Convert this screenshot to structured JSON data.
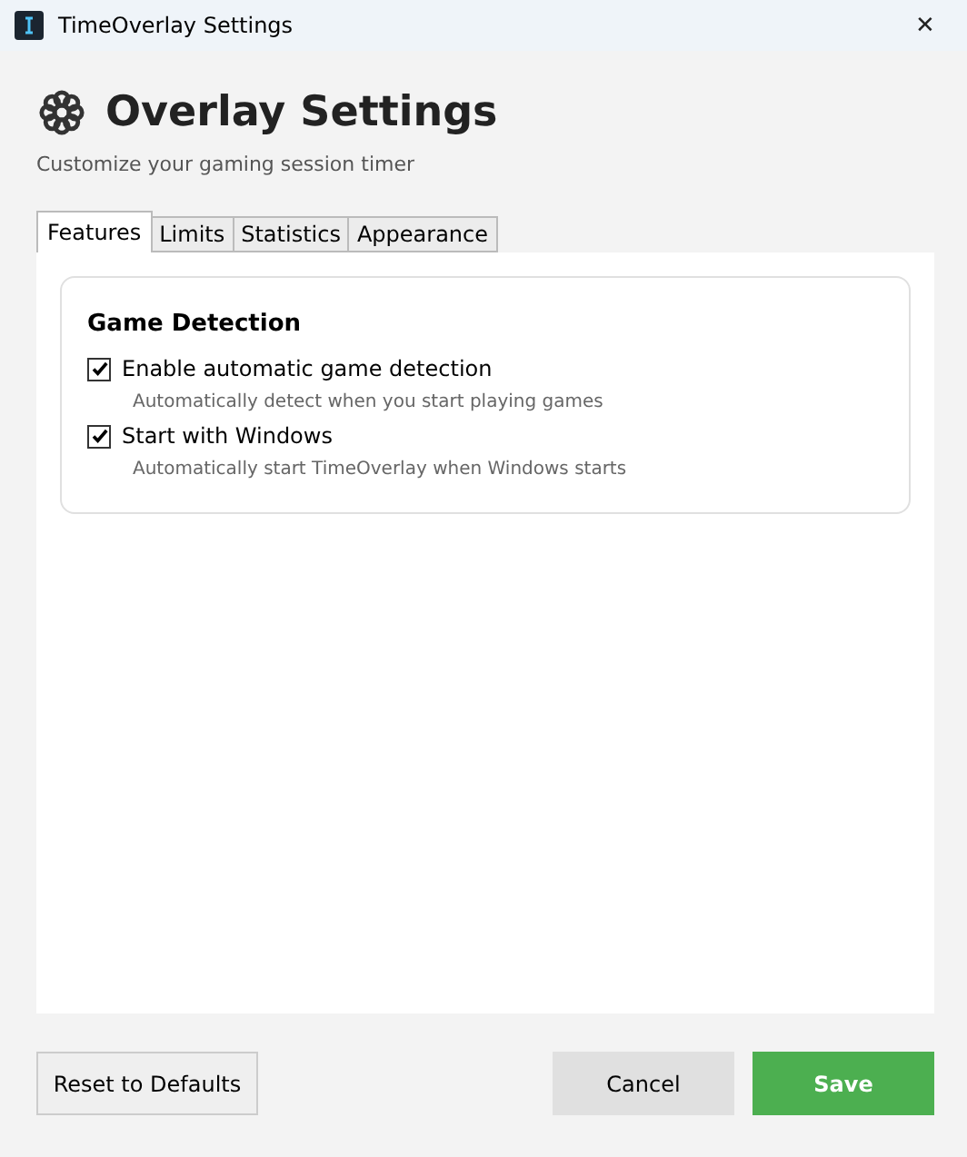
{
  "window": {
    "title": "TimeOverlay Settings",
    "close": "✕"
  },
  "header": {
    "title": "Overlay Settings",
    "subtitle": "Customize your gaming session timer"
  },
  "tabs": [
    {
      "label": "Features",
      "selected": true
    },
    {
      "label": "Limits",
      "selected": false
    },
    {
      "label": "Statistics",
      "selected": false
    },
    {
      "label": "Appearance",
      "selected": false
    }
  ],
  "section": {
    "title": "Game Detection",
    "options": [
      {
        "label": "Enable automatic game detection",
        "description": "Automatically detect when you start playing games",
        "checked": true
      },
      {
        "label": "Start with Windows",
        "description": "Automatically start TimeOverlay when Windows starts",
        "checked": true
      }
    ]
  },
  "buttons": {
    "reset": "Reset to Defaults",
    "cancel": "Cancel",
    "save": "Save"
  }
}
